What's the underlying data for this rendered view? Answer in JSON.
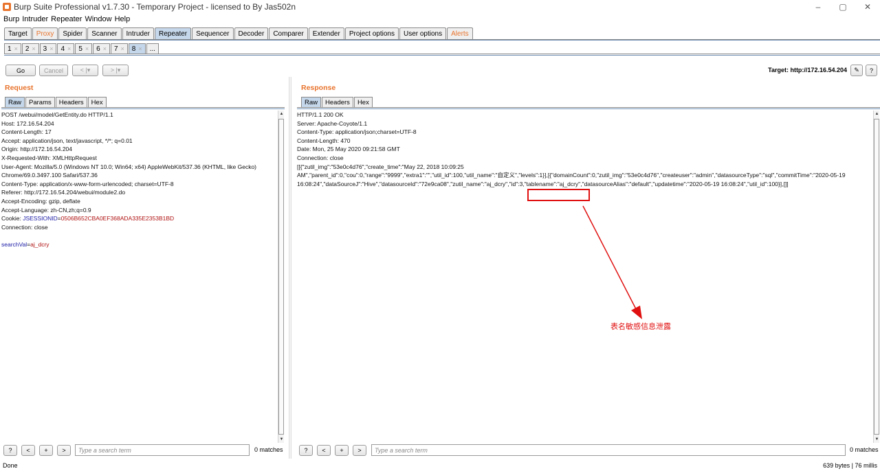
{
  "window": {
    "title": "Burp Suite Professional v1.7.30 - Temporary Project - licensed to By Jas502n",
    "controls": [
      "–",
      "▢",
      "✕"
    ]
  },
  "menu": [
    "Burp",
    "Intruder",
    "Repeater",
    "Window",
    "Help"
  ],
  "main_tabs": [
    {
      "label": "Target",
      "state": ""
    },
    {
      "label": "Proxy",
      "state": "orange"
    },
    {
      "label": "Spider",
      "state": ""
    },
    {
      "label": "Scanner",
      "state": ""
    },
    {
      "label": "Intruder",
      "state": ""
    },
    {
      "label": "Repeater",
      "state": "active"
    },
    {
      "label": "Sequencer",
      "state": ""
    },
    {
      "label": "Decoder",
      "state": ""
    },
    {
      "label": "Comparer",
      "state": ""
    },
    {
      "label": "Extender",
      "state": ""
    },
    {
      "label": "Project options",
      "state": ""
    },
    {
      "label": "User options",
      "state": ""
    },
    {
      "label": "Alerts",
      "state": "orange"
    }
  ],
  "repeater_tabs": [
    "1",
    "2",
    "3",
    "4",
    "5",
    "6",
    "7",
    "8",
    "..."
  ],
  "toolbar": {
    "go_label": "Go",
    "cancel_label": "Cancel",
    "back_label": "< |▾",
    "forward_label": "> |▾",
    "target_label": "Target: http://172.16.54.204",
    "edit_icon": "✎",
    "help_icon": "?"
  },
  "request": {
    "title": "Request",
    "tabs": [
      "Raw",
      "Params",
      "Headers",
      "Hex"
    ],
    "lines": [
      "POST /webui/model/GetEntity.do HTTP/1.1",
      "Host: 172.16.54.204",
      "Content-Length: 17",
      "Accept: application/json, text/javascript, */*; q=0.01",
      "Origin: http://172.16.54.204",
      "X-Requested-With: XMLHttpRequest",
      "User-Agent: Mozilla/5.0 (Windows NT 10.0; Win64; x64) AppleWebKit/537.36 (KHTML, like Gecko)",
      "Chrome/69.0.3497.100 Safari/537.36",
      "Content-Type: application/x-www-form-urlencoded; charset=UTF-8",
      "Referer: http://172.16.54.204/webui/module2.do",
      "Accept-Encoding: gzip, deflate",
      "Accept-Language: zh-CN,zh;q=0.9"
    ],
    "cookie_prefix": "Cookie: ",
    "cookie_name": "JSESSIONID",
    "cookie_eq": "=",
    "cookie_value": "0506B652CBA0EF368ADA335E2353B1BD",
    "connection": "Connection: close",
    "body_name": "searchVal",
    "body_eq": "=",
    "body_value": "aj_dcry"
  },
  "response": {
    "title": "Response",
    "tabs": [
      "Raw",
      "Headers",
      "Hex"
    ],
    "lines": [
      "HTTP/1.1 200 OK",
      "Server: Apache-Coyote/1.1",
      "Content-Type: application/json;charset=UTF-8",
      "Content-Length: 470",
      "Date: Mon, 25 May 2020 09:21:58 GMT",
      "Connection: close",
      "",
      "[[{\"zutil_img\":\"53e0c4d76\",\"create_time\":\"May 22, 2018 10:09:25",
      "AM\",\"parent_id\":0,\"cou\":0,\"range\":\"9999\",\"extra1\":\"\",\"util_id\":100,\"util_name\":\"自定义\",\"levels\":1}],[{\"domainCount\":0,\"zutil_img\":\"53e0c4d76\",\"createuser\":\"admin\",\"datasourceType\":\"sql\",\"commitTime\":\"2020-05-19",
      "16:08:24\",\"dataSourceJ\":\"Hive\",\"datasourceId\":\"72e9ca08\",\"zutil_name\":\"aj_dcry\",\"id\":3,\"tablename\":\"aj_dcry\",\"datasourceAlias\":\"default\",\"updatetime\":\"2020-05-19 16:08:24\",\"util_id\":100}],[]]"
    ]
  },
  "annotation": "表名敏感信息泄露",
  "search": {
    "help": "?",
    "prev": "<",
    "next": "+",
    "fwd": ">",
    "placeholder": "Type a search term",
    "request_matches": "0 matches",
    "response_matches": "0 matches"
  },
  "status": {
    "left": "Done",
    "right": "639 bytes | 76 millis"
  }
}
